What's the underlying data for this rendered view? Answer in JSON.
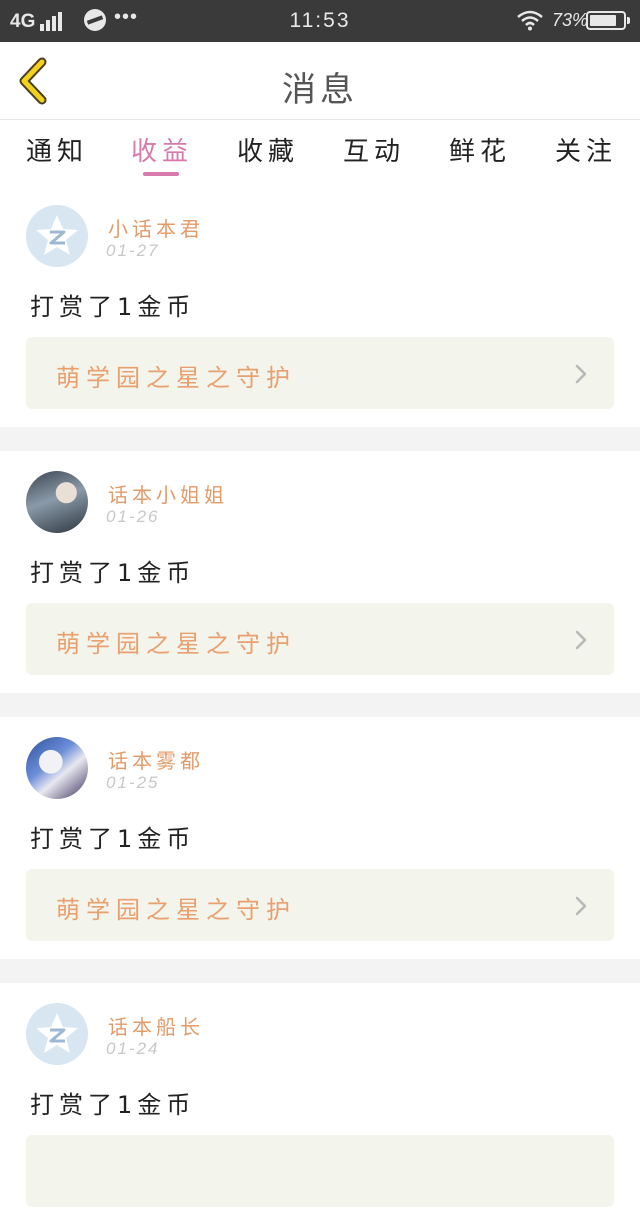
{
  "status_bar": {
    "network": "4G",
    "time": "11:53",
    "battery": "73%"
  },
  "nav": {
    "title": "消息"
  },
  "tabs": [
    {
      "label": "通知",
      "active": false
    },
    {
      "label": "收益",
      "active": true
    },
    {
      "label": "收藏",
      "active": false
    },
    {
      "label": "互动",
      "active": false
    },
    {
      "label": "鲜花",
      "active": false
    },
    {
      "label": "关注",
      "active": false
    }
  ],
  "colors": {
    "accent_pink": "#d77aac",
    "username_orange": "#e39b6a",
    "gift_orange": "#e9a06e",
    "gift_row_bg": "#f3f4ec",
    "back_arrow_yellow": "#f2d21b"
  },
  "feed": [
    {
      "user": "小话本君",
      "date": "01-27",
      "avatar": "default-avatar",
      "action": "打赏了1金币",
      "gift": "萌学园之星之守护"
    },
    {
      "user": "话本小姐姐",
      "date": "01-26",
      "avatar": "photo-avatar",
      "action": "打赏了1金币",
      "gift": "萌学园之星之守护"
    },
    {
      "user": "话本雾都",
      "date": "01-25",
      "avatar": "photo-avatar",
      "action": "打赏了1金币",
      "gift": "萌学园之星之守护"
    },
    {
      "user": "话本船长",
      "date": "01-24",
      "avatar": "default-avatar",
      "action": "打赏了1金币",
      "gift": ""
    }
  ]
}
